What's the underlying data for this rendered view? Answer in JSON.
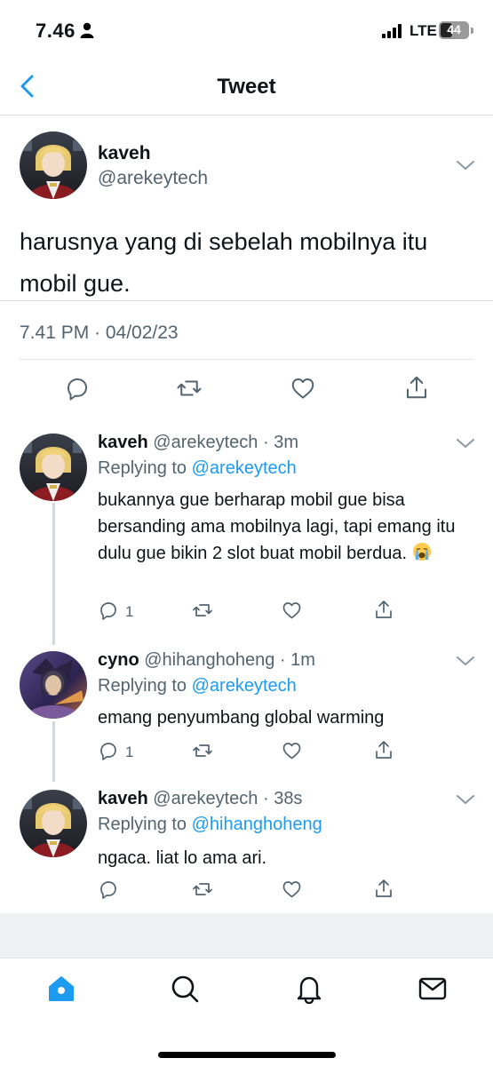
{
  "status_bar": {
    "time": "7.46",
    "network": "LTE",
    "battery": "44",
    "battery_level": 0.44
  },
  "header": {
    "title": "Tweet"
  },
  "main_tweet": {
    "name": "kaveh",
    "handle": "@arekeytech",
    "text": "harusnya yang di sebelah mobilnya itu mobil gue.",
    "timestamp": "7.41 PM · 04/02/23"
  },
  "replies": [
    {
      "name": "kaveh",
      "meta": "@arekeytech · 3m",
      "replying_prefix": "Replying to ",
      "replying_to": "@arekeytech",
      "text": "bukannya gue berharap mobil gue bisa bersanding ama mobilnya lagi, tapi emang itu dulu gue bikin 2 slot buat mobil berdua.",
      "emoji": "loudly-crying-face",
      "reply_count": "1"
    },
    {
      "name": "cyno",
      "meta": "@hihanghoheng · 1m",
      "replying_prefix": "Replying to ",
      "replying_to": "@arekeytech",
      "text": "emang penyumbang global warming",
      "reply_count": "1"
    },
    {
      "name": "kaveh",
      "meta": "@arekeytech · 38s",
      "replying_prefix": "Replying to ",
      "replying_to": "@hihanghoheng",
      "text": "ngaca. liat lo ama ari.",
      "reply_count": ""
    }
  ],
  "tab_bar": {
    "items": [
      "home-icon",
      "search-icon",
      "notifications-icon",
      "messages-icon"
    ]
  },
  "colors": {
    "accent": "#1d9bf0",
    "secondary_text": "#536471"
  }
}
